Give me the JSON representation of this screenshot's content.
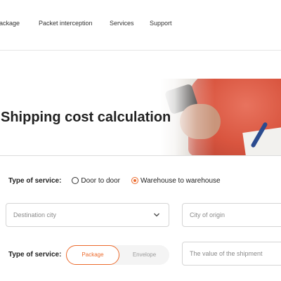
{
  "nav": {
    "items": [
      "package",
      "Packet interception",
      "Services",
      "Support"
    ]
  },
  "hero": {
    "title": "Shipping cost calculation"
  },
  "service_type": {
    "label": "Type of service:",
    "options": [
      "Door to door",
      "Warehouse to warehouse"
    ],
    "selected": "Warehouse to warehouse"
  },
  "fields": {
    "destination_placeholder": "Destination city",
    "origin_placeholder": "City of origin",
    "value_placeholder": "The value of the shipment"
  },
  "shipment_type": {
    "label": "Type of service:",
    "options": [
      "Package",
      "Envelope"
    ],
    "selected": "Package"
  },
  "colors": {
    "accent": "#ec6b2d",
    "border": "#d5d5d5",
    "text": "#222222"
  }
}
